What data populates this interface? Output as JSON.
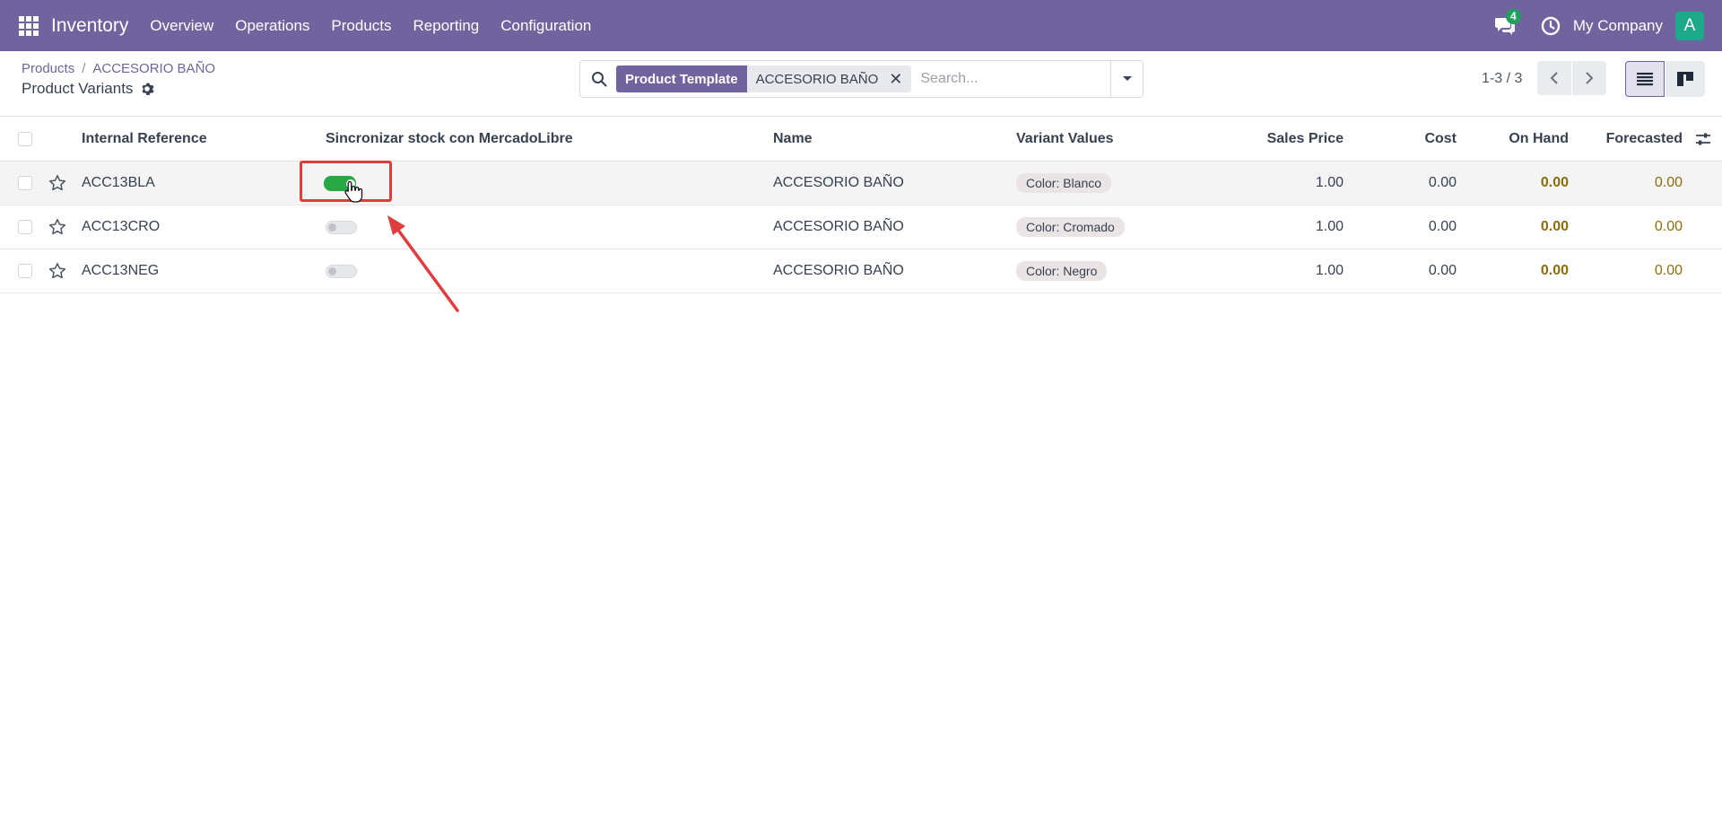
{
  "navbar": {
    "app_name": "Inventory",
    "menu": [
      "Overview",
      "Operations",
      "Products",
      "Reporting",
      "Configuration"
    ],
    "message_count": "4",
    "company": "My Company",
    "avatar_letter": "A"
  },
  "breadcrumb": {
    "items": [
      "Products",
      "ACCESORIO BAÑO"
    ],
    "separator": "/"
  },
  "page_title": "Product Variants",
  "search": {
    "facet_label": "Product Template",
    "facet_value": "ACCESORIO BAÑO",
    "placeholder": "Search..."
  },
  "pager": {
    "range": "1-3 / 3"
  },
  "table": {
    "headers": {
      "internal_reference": "Internal Reference",
      "sync": "Sincronizar stock con MercadoLibre",
      "name": "Name",
      "variant_values": "Variant Values",
      "sales_price": "Sales Price",
      "cost": "Cost",
      "on_hand": "On Hand",
      "forecasted": "Forecasted"
    },
    "rows": [
      {
        "ref": "ACC13BLA",
        "sync": true,
        "name": "ACCESORIO BAÑO",
        "variant": "Color: Blanco",
        "price": "1.00",
        "cost": "0.00",
        "on_hand": "0.00",
        "forecasted": "0.00"
      },
      {
        "ref": "ACC13CRO",
        "sync": false,
        "name": "ACCESORIO BAÑO",
        "variant": "Color: Cromado",
        "price": "1.00",
        "cost": "0.00",
        "on_hand": "0.00",
        "forecasted": "0.00"
      },
      {
        "ref": "ACC13NEG",
        "sync": false,
        "name": "ACCESORIO BAÑO",
        "variant": "Color: Negro",
        "price": "1.00",
        "cost": "0.00",
        "on_hand": "0.00",
        "forecasted": "0.00"
      }
    ]
  },
  "icons": {
    "apps": "apps-grid-icon",
    "chat": "chat-icon",
    "clock": "clock-icon",
    "search": "search-icon",
    "gear": "gear-icon",
    "star": "star-icon"
  },
  "colors": {
    "brand": "#71639e",
    "toggle_on": "#28a745",
    "annotation": "#e03c3c",
    "quantity": "#8a6d0b"
  }
}
